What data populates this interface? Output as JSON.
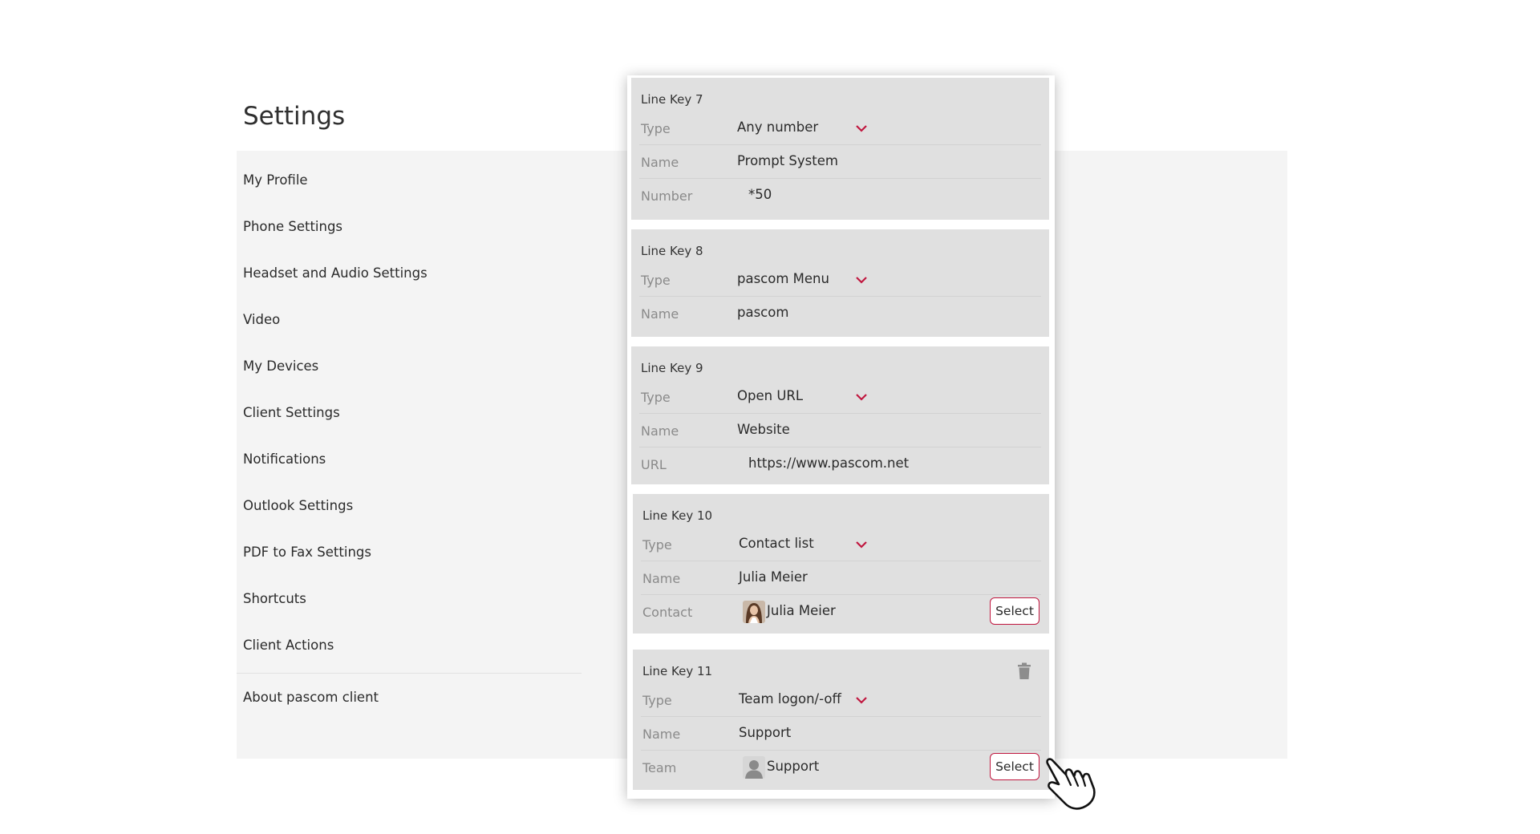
{
  "header": {
    "title": "Settings"
  },
  "sidebar": {
    "items": [
      {
        "label": "My Profile"
      },
      {
        "label": "Phone Settings"
      },
      {
        "label": "Headset and Audio Settings"
      },
      {
        "label": "Video"
      },
      {
        "label": "My Devices"
      },
      {
        "label": "Client Settings"
      },
      {
        "label": "Notifications"
      },
      {
        "label": "Outlook Settings"
      },
      {
        "label": "PDF to Fax Settings"
      },
      {
        "label": "Shortcuts"
      },
      {
        "label": "Client Actions"
      }
    ],
    "about": "About pascom client"
  },
  "line_keys": [
    {
      "title": "Line Key 7",
      "type_label": "Type",
      "type_value": "Any number",
      "name_label": "Name",
      "name_value": "Prompt System",
      "extra_label": "Number",
      "extra_value": "*50"
    },
    {
      "title": "Line Key 8",
      "type_label": "Type",
      "type_value": "pascom Menu",
      "name_label": "Name",
      "name_value": "pascom"
    },
    {
      "title": "Line Key 9",
      "type_label": "Type",
      "type_value": "Open URL",
      "name_label": "Name",
      "name_value": "Website",
      "extra_label": "URL",
      "extra_value": "https://www.pascom.net"
    },
    {
      "title": "Line Key 10",
      "type_label": "Type",
      "type_value": "Contact list",
      "name_label": "Name",
      "name_value": "Julia Meier",
      "extra_label": "Contact",
      "extra_value": "Julia Meier",
      "button": "Select"
    },
    {
      "title": "Line Key 11",
      "type_label": "Type",
      "type_value": "Team logon/-off",
      "name_label": "Name",
      "name_value": "Support",
      "extra_label": "Team",
      "extra_value": "Support",
      "button": "Select"
    }
  ],
  "colors": {
    "accent": "#c0173f",
    "card_bg": "#e0e0e0",
    "page_panel_bg": "#f4f4f4",
    "label_gray": "#8a8a8a"
  },
  "icons": {
    "dropdown": "chevron-down-icon",
    "delete": "trash-icon",
    "contact_avatar": "avatar-photo",
    "team_avatar": "person-silhouette-icon",
    "pointer": "hand-cursor-icon"
  }
}
